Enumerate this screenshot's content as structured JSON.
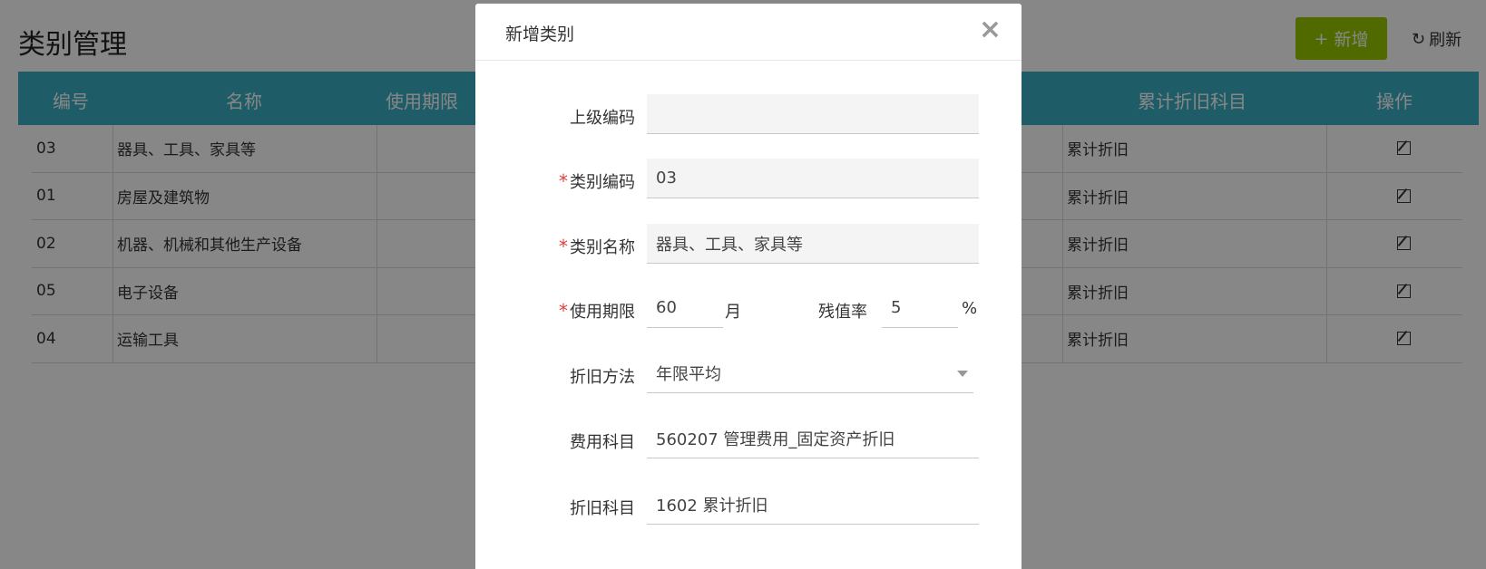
{
  "page": {
    "title": "类别管理",
    "add_label": "新增",
    "refresh_label": "刷新"
  },
  "table": {
    "headers": {
      "code": "编号",
      "name": "名称",
      "period": "使用期限",
      "accum": "累计折旧科目",
      "ops": "操作"
    },
    "rows": [
      {
        "code": "03",
        "name": "器具、工具、家具等",
        "accum": "累计折旧"
      },
      {
        "code": "01",
        "name": "房屋及建筑物",
        "accum": "累计折旧"
      },
      {
        "code": "02",
        "name": "机器、机械和其他生产设备",
        "accum": "累计折旧"
      },
      {
        "code": "05",
        "name": "电子设备",
        "accum": "累计折旧"
      },
      {
        "code": "04",
        "name": "运输工具",
        "accum": "累计折旧"
      }
    ]
  },
  "modal": {
    "title": "新增类别",
    "close_symbol": "×",
    "parent_code": {
      "label": "上级编码",
      "value": ""
    },
    "category_code": {
      "label": "类别编码",
      "value": "03"
    },
    "category_name": {
      "label": "类别名称",
      "value": "器具、工具、家具等"
    },
    "period": {
      "label": "使用期限",
      "value": "60",
      "unit": "月"
    },
    "residual": {
      "label": "残值率",
      "value": "5",
      "unit": "%"
    },
    "method": {
      "label": "折旧方法",
      "value": "年限平均"
    },
    "expense_subject": {
      "label": "费用科目",
      "value": "560207  管理费用_固定资产折旧"
    },
    "depr_subject": {
      "label": "折旧科目",
      "value": "1602  累计折旧"
    },
    "required_mark": "*"
  }
}
